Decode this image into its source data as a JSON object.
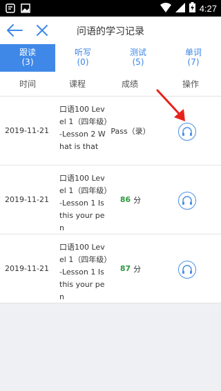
{
  "status_bar": {
    "time": "4:27"
  },
  "header": {
    "title": "问语的学习记录"
  },
  "tabs": [
    {
      "label": "跟读",
      "count": "(3)"
    },
    {
      "label": "听写",
      "count": "(0)"
    },
    {
      "label": "测试",
      "count": "(5)"
    },
    {
      "label": "单词",
      "count": "(7)"
    }
  ],
  "columns": {
    "time": "时间",
    "course": "课程",
    "score": "成绩",
    "action": "操作"
  },
  "records": [
    {
      "date": "2019-11-21",
      "course": "口语100 Level 1（四年级）-Lesson 2 What is that",
      "score_text": "Pass（录）",
      "score_num": "",
      "score_unit": ""
    },
    {
      "date": "2019-11-21",
      "course": "口语100 Level 1（四年级）-Lesson 1 Is this your pen",
      "score_text": "",
      "score_num": "86",
      "score_unit": "分"
    },
    {
      "date": "2019-11-21",
      "course": "口语100 Level 1（四年级）-Lesson 1 Is this your pen",
      "score_text": "",
      "score_num": "87",
      "score_unit": "分"
    }
  ],
  "colors": {
    "accent": "#3f88e8",
    "score_green": "#2e9a3c",
    "annotation_arrow": "#e8221c"
  }
}
